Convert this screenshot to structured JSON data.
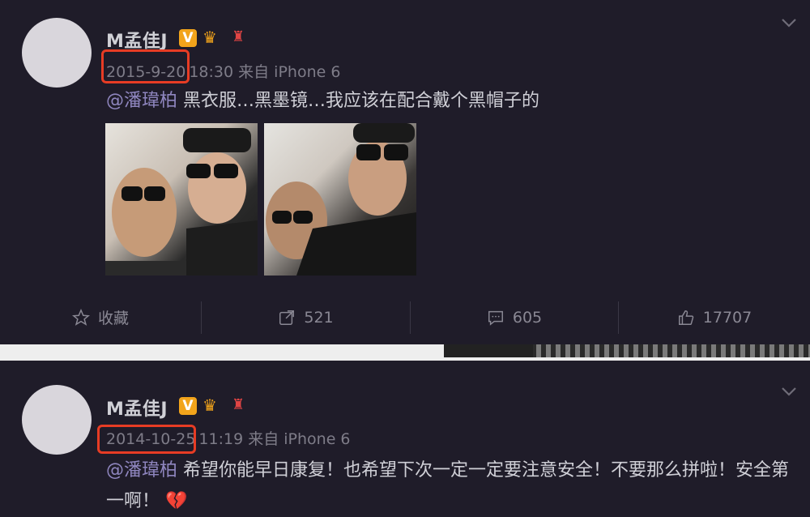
{
  "posts": [
    {
      "username": "M孟佳J",
      "badge_v": "V",
      "date": "2015-9-20",
      "time_source": "18:30 来自 iPhone 6",
      "mention": "@潘瑋柏",
      "text": "黑衣服…黑墨镜…我应该在配合戴个黑帽子的",
      "actions": {
        "favorite_label": "收藏",
        "repost_count": "521",
        "comment_count": "605",
        "like_count": "17707"
      }
    },
    {
      "username": "M孟佳J",
      "badge_v": "V",
      "date": "2014-10-25",
      "time_source": "11:19 来自 iPhone 6",
      "mention": "@潘瑋柏",
      "text": "希望你能早日康复！也希望下次一定一定要注意安全！不要那么拼啦！安全第一啊！",
      "emoji": "💔"
    }
  ],
  "colors": {
    "background": "#1f1c29",
    "mention": "#8f86bf",
    "highlight": "#e73c24",
    "badge": "#f2a41b"
  },
  "icons": [
    "star-icon",
    "repost-icon",
    "comment-icon",
    "like-icon",
    "chevron-down-icon",
    "crown-icon",
    "torch-icon"
  ]
}
